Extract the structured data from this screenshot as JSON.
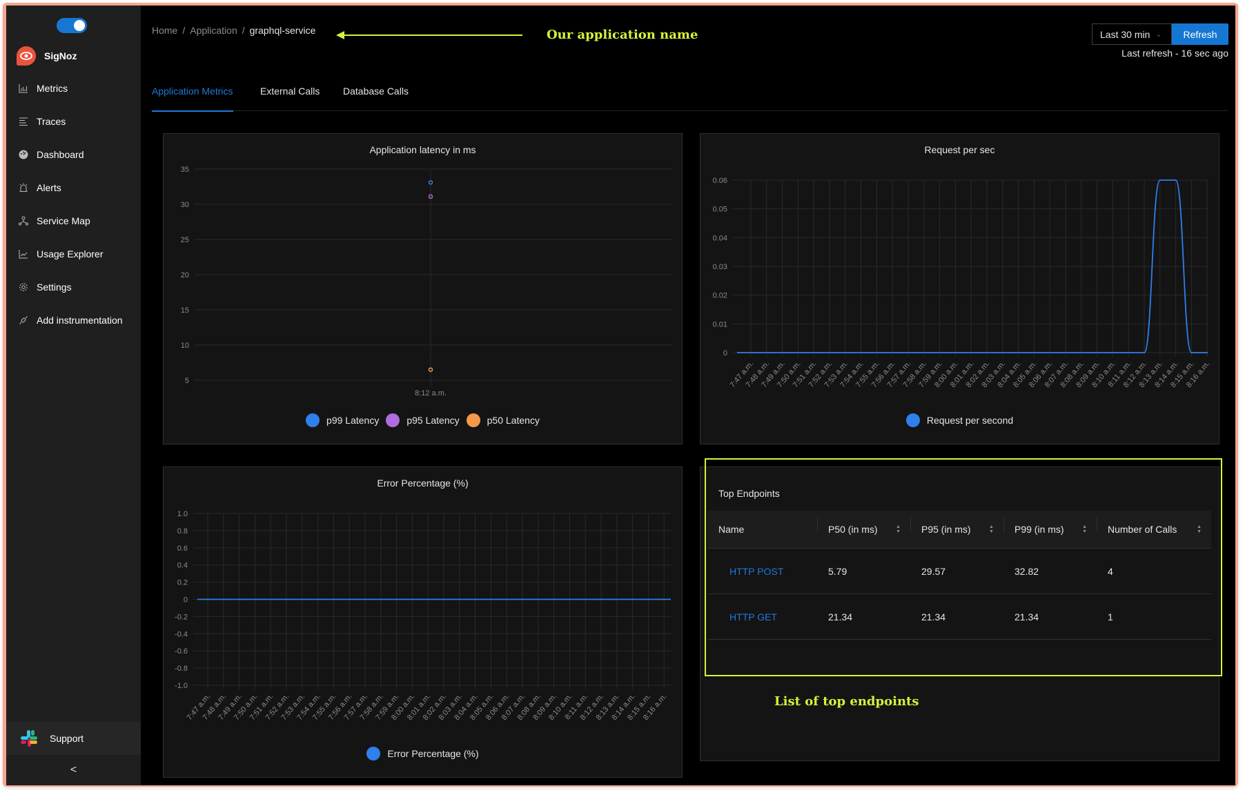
{
  "sidebar": {
    "toggle_on": true,
    "brand": "SigNoz",
    "items": [
      {
        "label": "Metrics",
        "icon": "bar-chart-icon"
      },
      {
        "label": "Traces",
        "icon": "align-left-icon"
      },
      {
        "label": "Dashboard",
        "icon": "dashboard-icon"
      },
      {
        "label": "Alerts",
        "icon": "alarm-icon"
      },
      {
        "label": "Service Map",
        "icon": "deployment-unit-icon"
      },
      {
        "label": "Usage Explorer",
        "icon": "line-chart-icon"
      },
      {
        "label": "Settings",
        "icon": "gear-icon"
      },
      {
        "label": "Add instrumentation",
        "icon": "api-icon"
      }
    ],
    "support_label": "Support",
    "collapse_label": "<"
  },
  "header": {
    "breadcrumb": [
      "Home",
      "Application",
      "graphql-service"
    ],
    "breadcrumb_separator": "/",
    "time_range": "Last 30 min",
    "refresh_label": "Refresh",
    "last_refresh": "Last refresh - 16 sec ago"
  },
  "annotations": {
    "app_name_note": "Our application name",
    "endpoints_note": "List of top endpoints",
    "color": "#d9f23b"
  },
  "tabs": [
    {
      "label": "Application Metrics",
      "active": true
    },
    {
      "label": "External Calls",
      "active": false
    },
    {
      "label": "Database Calls",
      "active": false
    }
  ],
  "colors": {
    "accent": "#1677d3",
    "p99": "#2f80ed",
    "p95": "#b06ce0",
    "p50": "#f2994a",
    "series": "#2f80ed"
  },
  "chart_data": [
    {
      "type": "scatter",
      "title": "Application latency in ms",
      "xlabel": "",
      "ylabel": "",
      "categories": [
        "8:12 a.m."
      ],
      "ylim": [
        5,
        35
      ],
      "yticks": [
        "35",
        "30",
        "25",
        "20",
        "15",
        "10",
        "5"
      ],
      "grid": true,
      "legend": "bottom",
      "series": [
        {
          "name": "p99 Latency",
          "values": [
            33.1
          ]
        },
        {
          "name": "p95 Latency",
          "values": [
            31.1
          ]
        },
        {
          "name": "p50 Latency",
          "values": [
            6.5
          ]
        }
      ]
    },
    {
      "type": "line",
      "title": "Request per sec",
      "xlabel": "",
      "ylabel": "",
      "categories": [
        "7:47 a.m.",
        "7:48 a.m.",
        "7:49 a.m.",
        "7:50 a.m.",
        "7:51 a.m.",
        "7:52 a.m.",
        "7:53 a.m.",
        "7:54 a.m.",
        "7:55 a.m.",
        "7:56 a.m.",
        "7:57 a.m.",
        "7:58 a.m.",
        "7:59 a.m.",
        "8:00 a.m.",
        "8:01 a.m.",
        "8:02 a.m.",
        "8:03 a.m.",
        "8:04 a.m.",
        "8:05 a.m.",
        "8:06 a.m.",
        "8:07 a.m.",
        "8:08 a.m.",
        "8:09 a.m.",
        "8:10 a.m.",
        "8:11 a.m.",
        "8:12 a.m.",
        "8:13 a.m.",
        "8:14 a.m.",
        "8:15 a.m.",
        "8:16 a.m."
      ],
      "ylim": [
        0,
        0.06
      ],
      "yticks": [
        "0.06",
        "0.05",
        "0.04",
        "0.03",
        "0.02",
        "0.01",
        "0"
      ],
      "grid": true,
      "legend": "bottom",
      "series": [
        {
          "name": "Request per second",
          "values": [
            0,
            0,
            0,
            0,
            0,
            0,
            0,
            0,
            0,
            0,
            0,
            0,
            0,
            0,
            0,
            0,
            0,
            0,
            0,
            0,
            0,
            0,
            0,
            0,
            0,
            0,
            0.06,
            0.06,
            0,
            0
          ]
        }
      ]
    },
    {
      "type": "line",
      "title": "Error Percentage (%)",
      "xlabel": "",
      "ylabel": "",
      "categories": [
        "7:47 a.m.",
        "7:48 a.m.",
        "7:49 a.m.",
        "7:50 a.m.",
        "7:51 a.m.",
        "7:52 a.m.",
        "7:53 a.m.",
        "7:54 a.m.",
        "7:55 a.m.",
        "7:56 a.m.",
        "7:57 a.m.",
        "7:58 a.m.",
        "7:59 a.m.",
        "8:00 a.m.",
        "8:01 a.m.",
        "8:02 a.m.",
        "8:03 a.m.",
        "8:04 a.m.",
        "8:05 a.m.",
        "8:06 a.m.",
        "8:07 a.m.",
        "8:08 a.m.",
        "8:09 a.m.",
        "8:10 a.m.",
        "8:11 a.m.",
        "8:12 a.m.",
        "8:13 a.m.",
        "8:14 a.m.",
        "8:15 a.m.",
        "8:16 a.m."
      ],
      "ylim": [
        -1.0,
        1.0
      ],
      "yticks": [
        "1.0",
        "0.8",
        "0.6",
        "0.4",
        "0.2",
        "0",
        "-0.2",
        "-0.4",
        "-0.6",
        "-0.8",
        "-1.0"
      ],
      "grid": true,
      "legend": "bottom",
      "series": [
        {
          "name": "Error Percentage (%)",
          "values": [
            0,
            0,
            0,
            0,
            0,
            0,
            0,
            0,
            0,
            0,
            0,
            0,
            0,
            0,
            0,
            0,
            0,
            0,
            0,
            0,
            0,
            0,
            0,
            0,
            0,
            0,
            0,
            0,
            0,
            0
          ]
        }
      ]
    }
  ],
  "top_endpoints": {
    "title": "Top Endpoints",
    "columns": [
      "Name",
      "P50 (in ms)",
      "P95 (in ms)",
      "P99 (in ms)",
      "Number of Calls"
    ],
    "rows": [
      {
        "name": "HTTP POST",
        "p50": "5.79",
        "p95": "29.57",
        "p99": "32.82",
        "calls": "4"
      },
      {
        "name": "HTTP GET",
        "p50": "21.34",
        "p95": "21.34",
        "p99": "21.34",
        "calls": "1"
      }
    ]
  }
}
